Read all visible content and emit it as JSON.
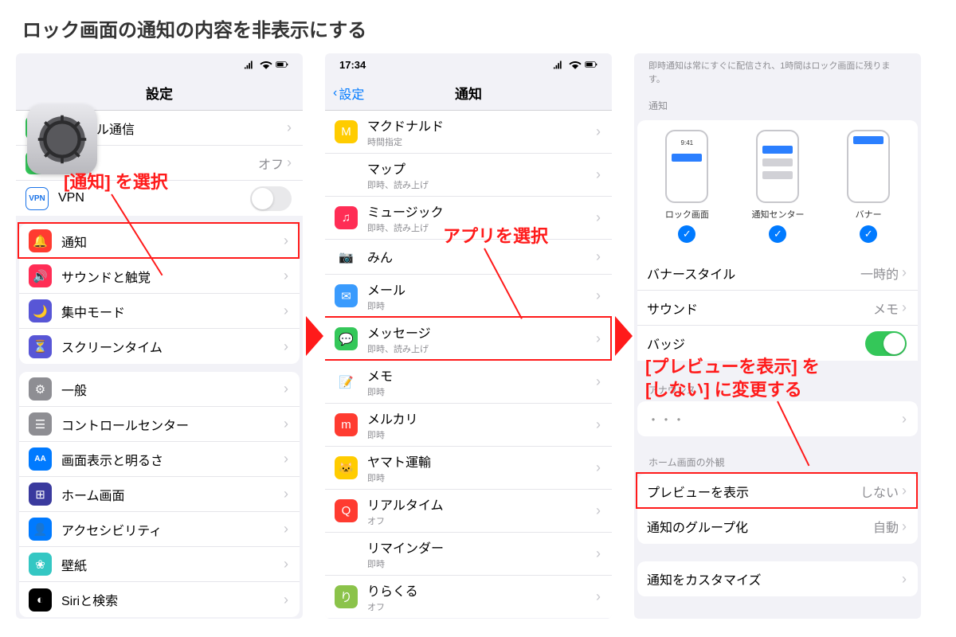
{
  "page_title": "ロック画面の通知の内容を非表示にする",
  "annotations": {
    "a1": "[通知] を選択",
    "a2": "アプリを選択",
    "a3_line1": "[プレビューを表示] を",
    "a3_line2": "[しない] に変更する"
  },
  "phone1": {
    "nav_title": "設定",
    "rows_top": [
      {
        "icon_bg": "#34c759",
        "icon_glyph": "📶",
        "label": "モバイル通信"
      },
      {
        "icon_bg": "#34c759",
        "icon_glyph": "🔗",
        "label": "",
        "value": "オフ",
        "truncated": true
      },
      {
        "icon_bg": "#1a73e8",
        "icon_glyph": "VPN",
        "label": "VPN",
        "toggle": "off",
        "text_icon": true
      }
    ],
    "rows_mid": [
      {
        "icon_bg": "#ff3b30",
        "icon_glyph": "🔔",
        "label": "通知",
        "highlight": true
      },
      {
        "icon_bg": "#ff2d55",
        "icon_glyph": "🔊",
        "label": "サウンドと触覚"
      },
      {
        "icon_bg": "#5856d6",
        "icon_glyph": "🌙",
        "label": "集中モード"
      },
      {
        "icon_bg": "#5856d6",
        "icon_glyph": "⏳",
        "label": "スクリーンタイム"
      }
    ],
    "rows_bot": [
      {
        "icon_bg": "#8e8e93",
        "icon_glyph": "⚙",
        "label": "一般"
      },
      {
        "icon_bg": "#8e8e93",
        "icon_glyph": "☰",
        "label": "コントロールセンター"
      },
      {
        "icon_bg": "#007aff",
        "icon_glyph": "AA",
        "label": "画面表示と明るさ",
        "text_icon": true
      },
      {
        "icon_bg": "#3a3a9e",
        "icon_glyph": "⊞",
        "label": "ホーム画面"
      },
      {
        "icon_bg": "#007aff",
        "icon_glyph": "👤",
        "label": "アクセシビリティ"
      },
      {
        "icon_bg": "#34c7c3",
        "icon_glyph": "❀",
        "label": "壁紙"
      },
      {
        "icon_bg": "#000",
        "icon_glyph": "◐",
        "label": "Siriと検索"
      }
    ]
  },
  "phone2": {
    "time": "17:34",
    "back": "設定",
    "nav_title": "通知",
    "rows": [
      {
        "icon_bg": "#ffcc00",
        "glyph": "M",
        "label": "マクドナルド",
        "sub": "時間指定"
      },
      {
        "icon_bg": "#fff",
        "glyph": "🗺",
        "label": "マップ",
        "sub": "即時、読み上げ"
      },
      {
        "icon_bg": "#ff2d55",
        "glyph": "♫",
        "label": "ミュージック",
        "sub": "即時、読み上げ"
      },
      {
        "icon_bg": "#fff",
        "glyph": "📷",
        "label": "みん",
        "sub": "",
        "truncated": true
      },
      {
        "icon_bg": "#3a9bfd",
        "glyph": "✉",
        "label": "メール",
        "sub": "即時"
      },
      {
        "icon_bg": "#34c759",
        "glyph": "💬",
        "label": "メッセージ",
        "sub": "即時、読み上げ",
        "highlight": true
      },
      {
        "icon_bg": "#fff",
        "glyph": "📝",
        "label": "メモ",
        "sub": "即時"
      },
      {
        "icon_bg": "#ff3b30",
        "glyph": "m",
        "label": "メルカリ",
        "sub": "即時"
      },
      {
        "icon_bg": "#ffcc00",
        "glyph": "🐱",
        "label": "ヤマト運輸",
        "sub": "即時"
      },
      {
        "icon_bg": "#ff3b30",
        "glyph": "Q",
        "label": "リアルタイム",
        "sub": "オフ"
      },
      {
        "icon_bg": "#fff",
        "glyph": "⋮",
        "label": "リマインダー",
        "sub": "即時"
      },
      {
        "icon_bg": "#8bc34a",
        "glyph": "り",
        "label": "りらくる",
        "sub": "オフ"
      }
    ]
  },
  "phone3": {
    "top_note": "即時通知は常にすぐに配信され、1時間はロック画面に残ります。",
    "section_notif": "通知",
    "types": [
      {
        "label": "ロック画面"
      },
      {
        "label": "通知センター"
      },
      {
        "label": "バナー"
      }
    ],
    "rows1": [
      {
        "label": "バナースタイル",
        "value": "一時的"
      },
      {
        "label": "サウンド",
        "value": "メモ"
      },
      {
        "label": "バッジ",
        "toggle": "on"
      }
    ],
    "section_announce": "アナウンス",
    "section_home": "ホーム画面の外観",
    "rows2": [
      {
        "label": "プレビューを表示",
        "value": "しない",
        "highlight": true
      },
      {
        "label": "通知のグループ化",
        "value": "自動"
      }
    ],
    "rows3": [
      {
        "label": "通知をカスタマイズ"
      }
    ]
  }
}
